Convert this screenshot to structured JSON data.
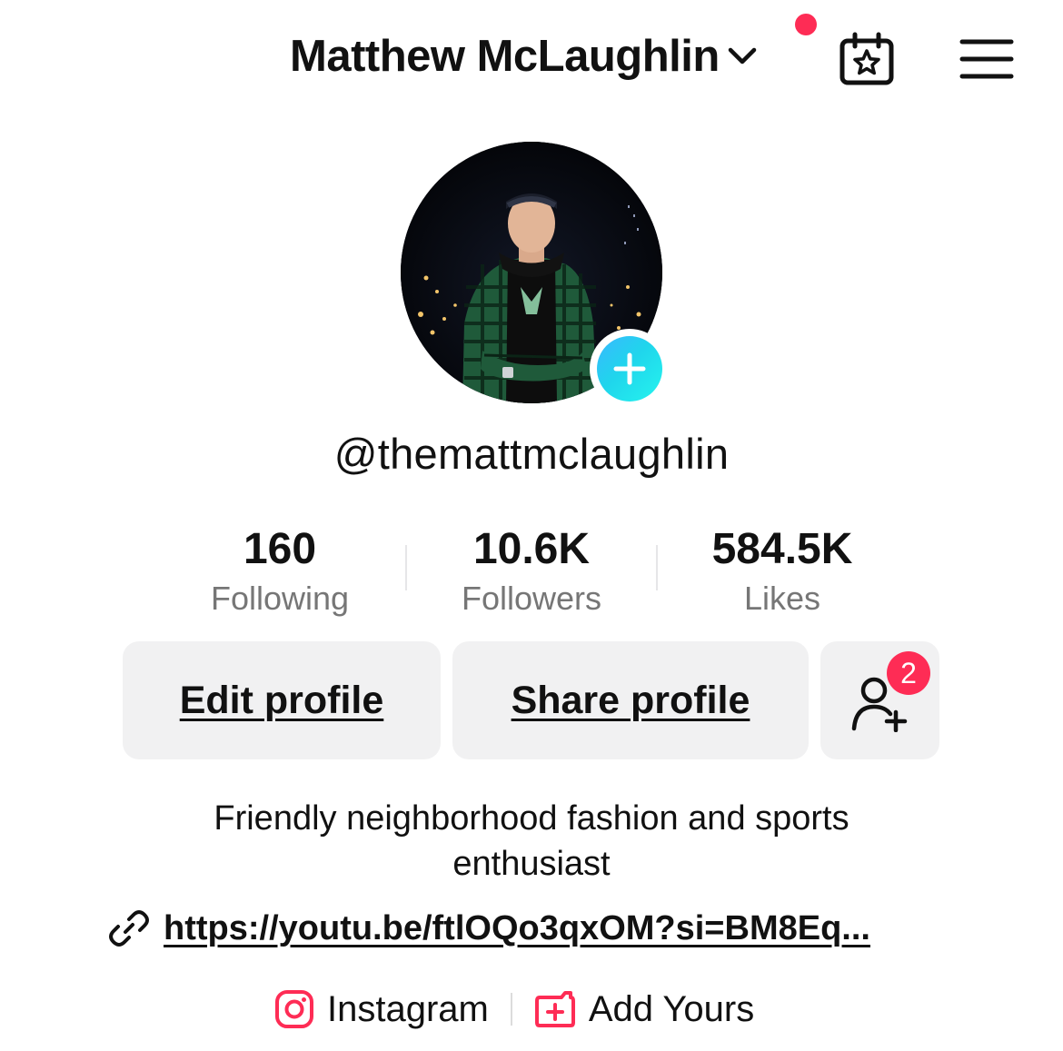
{
  "header": {
    "display_name": "Matthew McLaughlin",
    "has_notification": true
  },
  "profile": {
    "username": "@themattmclaughlin",
    "bio_line1": "Friendly neighborhood fashion and sports",
    "bio_line2": "enthusiast",
    "link": "https://youtu.be/ftlOQo3qxOM?si=BM8Eq..."
  },
  "stats": [
    {
      "value": "160",
      "label": "Following"
    },
    {
      "value": "10.6K",
      "label": "Followers"
    },
    {
      "value": "584.5K",
      "label": "Likes"
    }
  ],
  "actions": {
    "edit_profile": "Edit profile",
    "share_profile": "Share profile",
    "friend_requests_badge": "2"
  },
  "chips": {
    "instagram": "Instagram",
    "add_yours": "Add Yours"
  },
  "colors": {
    "accent": "#fe2c55",
    "avatar_add": "#20d5ec",
    "button_bg": "#f1f1f2",
    "muted_text": "#767676"
  },
  "icons": [
    "chevron-down-icon",
    "calendar-star-icon",
    "menu-icon",
    "plus-icon",
    "add-friend-icon",
    "link-icon",
    "instagram-icon",
    "add-yours-icon"
  ]
}
